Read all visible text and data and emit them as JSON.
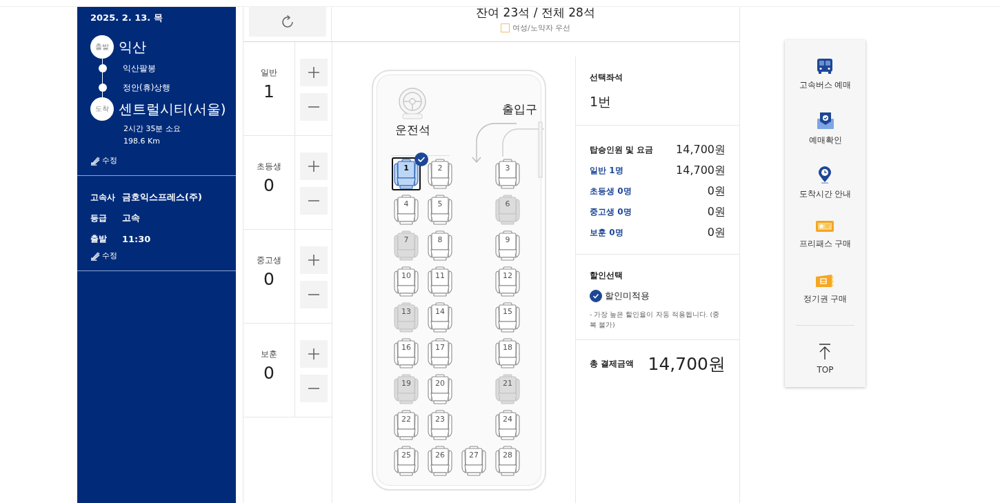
{
  "trip": {
    "date": "2025. 2. 13. 목",
    "departure": {
      "badge": "출발",
      "name": "익산"
    },
    "stops": [
      "익산팔봉",
      "정안(휴)상행"
    ],
    "arrival": {
      "badge": "도착",
      "name": "센트럴시티(서울)"
    },
    "duration": "2시간 35분 소요",
    "distance": "198.6 Km",
    "edit_label": "수정"
  },
  "bus_info": {
    "rows": [
      {
        "label": "고속사",
        "value": "금호익스프레스(주)"
      },
      {
        "label": "등급",
        "value": "고속"
      },
      {
        "label": "출발",
        "value": "11:30"
      }
    ],
    "edit_label": "수정"
  },
  "seat_header": {
    "title": "잔여 23석 / 전체 28석",
    "legend": "여성/노약자 우선"
  },
  "passengers": [
    {
      "label": "일반",
      "count": "1"
    },
    {
      "label": "초등생",
      "count": "0"
    },
    {
      "label": "중고생",
      "count": "0"
    },
    {
      "label": "보훈",
      "count": "0"
    }
  ],
  "seat_map": {
    "driver_label": "운전석",
    "door_label": "출입구",
    "rows": [
      {
        "seats": [
          {
            "number": "1",
            "selected": true,
            "reserved": false
          },
          {
            "number": "2",
            "selected": false,
            "reserved": false
          },
          {
            "number": "3",
            "selected": false,
            "reserved": false
          }
        ]
      },
      {
        "seats": [
          {
            "number": "4",
            "selected": false,
            "reserved": false
          },
          {
            "number": "5",
            "selected": false,
            "reserved": false
          },
          {
            "number": "6",
            "selected": false,
            "reserved": true
          }
        ]
      },
      {
        "seats": [
          {
            "number": "7",
            "selected": false,
            "reserved": true
          },
          {
            "number": "8",
            "selected": false,
            "reserved": false
          },
          {
            "number": "9",
            "selected": false,
            "reserved": false
          }
        ]
      },
      {
        "seats": [
          {
            "number": "10",
            "selected": false,
            "reserved": false
          },
          {
            "number": "11",
            "selected": false,
            "reserved": false
          },
          {
            "number": "12",
            "selected": false,
            "reserved": false
          }
        ]
      },
      {
        "seats": [
          {
            "number": "13",
            "selected": false,
            "reserved": true
          },
          {
            "number": "14",
            "selected": false,
            "reserved": false
          },
          {
            "number": "15",
            "selected": false,
            "reserved": false
          }
        ]
      },
      {
        "seats": [
          {
            "number": "16",
            "selected": false,
            "reserved": false
          },
          {
            "number": "17",
            "selected": false,
            "reserved": false
          },
          {
            "number": "18",
            "selected": false,
            "reserved": false
          }
        ]
      },
      {
        "seats": [
          {
            "number": "19",
            "selected": false,
            "reserved": true
          },
          {
            "number": "20",
            "selected": false,
            "reserved": false
          },
          {
            "number": "21",
            "selected": false,
            "reserved": true
          }
        ]
      },
      {
        "seats": [
          {
            "number": "22",
            "selected": false,
            "reserved": false
          },
          {
            "number": "23",
            "selected": false,
            "reserved": false
          },
          {
            "number": "24",
            "selected": false,
            "reserved": false
          }
        ]
      },
      {
        "seats": [
          {
            "number": "25",
            "selected": false,
            "reserved": false
          },
          {
            "number": "26",
            "selected": false,
            "reserved": false
          },
          {
            "number": "27",
            "selected": false,
            "reserved": false
          },
          {
            "number": "28",
            "selected": false,
            "reserved": false
          }
        ]
      }
    ]
  },
  "summary": {
    "seat_title": "선택좌석",
    "seat_value": "1번",
    "fare_title": "탑승인원 및 요금",
    "fare_total": "14,700원",
    "fares": [
      {
        "label": "일반 1명",
        "amount": "14,700원"
      },
      {
        "label": "초등생 0명",
        "amount": "0원"
      },
      {
        "label": "중고생 0명",
        "amount": "0원"
      },
      {
        "label": "보훈 0명",
        "amount": "0원"
      }
    ],
    "discount_title": "할인선택",
    "discount_option": {
      "label": "할인미적용",
      "checked": true
    },
    "discount_note": "- 가장 높은 할인율이 자동 적용됩니다. (중복 불가)",
    "total_label": "총 결제금액",
    "total_value": "14,700원"
  },
  "quick_menu": {
    "items": [
      {
        "kind": "bus",
        "label": "고속버스 예매"
      },
      {
        "kind": "confirm",
        "label": "예매확인"
      },
      {
        "kind": "arrival",
        "label": "도착시간 안내"
      },
      {
        "kind": "freepass",
        "label": "프리패스 구매"
      },
      {
        "kind": "season",
        "label": "정기권 구매"
      }
    ],
    "top_label": "TOP"
  }
}
